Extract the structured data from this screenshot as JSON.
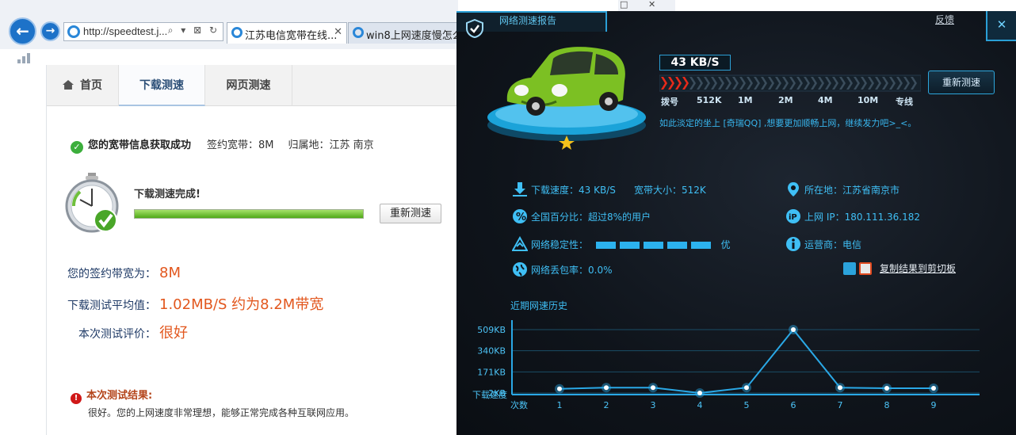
{
  "browser": {
    "url": "http://speedtest.j...",
    "url_tools": "⌕ ▾ ⊠ ↻",
    "tabs": [
      {
        "label": "江苏电信宽带在线...",
        "close": "✕"
      },
      {
        "label": "win8上网速度慢怎么..."
      }
    ]
  },
  "site": {
    "nav": [
      "首页",
      "下载测速",
      "网页测速"
    ],
    "status": {
      "ok": "您的宽带信息获取成功",
      "bandwidth": "签约宽带：8M",
      "location": "归属地：江苏 南京"
    },
    "done_label": "下载测速完成!",
    "progress_percent": 100,
    "retest": "重新测速",
    "results": [
      {
        "label": "您的签约带宽为：",
        "value": "8M"
      },
      {
        "label": "下载测试平均值：",
        "value": "1.02MB/S 约为8.2M带宽"
      },
      {
        "label": "本次测试评价：",
        "value": "很好"
      }
    ],
    "final_title": "本次测试结果:",
    "final_desc": "很好。您的上网速度非常理想，能够正常完成各种互联网应用。"
  },
  "report": {
    "title": "网络测速报告",
    "feedback": "反馈",
    "close": "✕",
    "speed": "43 KB/S",
    "ticks": [
      "拨号",
      "512K",
      "1M",
      "2M",
      "4M",
      "10M",
      "专线"
    ],
    "retest": "重新测速",
    "tip": "如此淡定的坐上 [奇瑞QQ] ,想要更加顺畅上网，继续发力吧>_<。",
    "info": {
      "download": "下载速度：43 KB/S",
      "bandwidth": "宽带大小：512K",
      "location": "所在地：江苏省南京市",
      "percent": "全国百分比：超过8%的用户",
      "ip": "上网 IP：180.111.36.182",
      "stability_label": "网络稳定性：",
      "stability_level": 5,
      "stability_word": "优",
      "isp": "运营商：电信",
      "loss": "网络丢包率：0.0%",
      "copy": "复制结果到剪切板"
    },
    "history_label": "近期网速历史"
  },
  "chart_data": {
    "type": "line",
    "xlabel": "次数",
    "ylabel": "下载速度",
    "yticks": [
      "2KB",
      "171KB",
      "340KB",
      "509KB"
    ],
    "x": [
      1,
      2,
      3,
      4,
      5,
      6,
      7,
      8,
      9
    ],
    "values": [
      35,
      45,
      45,
      2,
      45,
      509,
      45,
      40,
      40
    ],
    "colors": {
      "line": "#2aa8e6",
      "point": "#ffffff"
    }
  }
}
